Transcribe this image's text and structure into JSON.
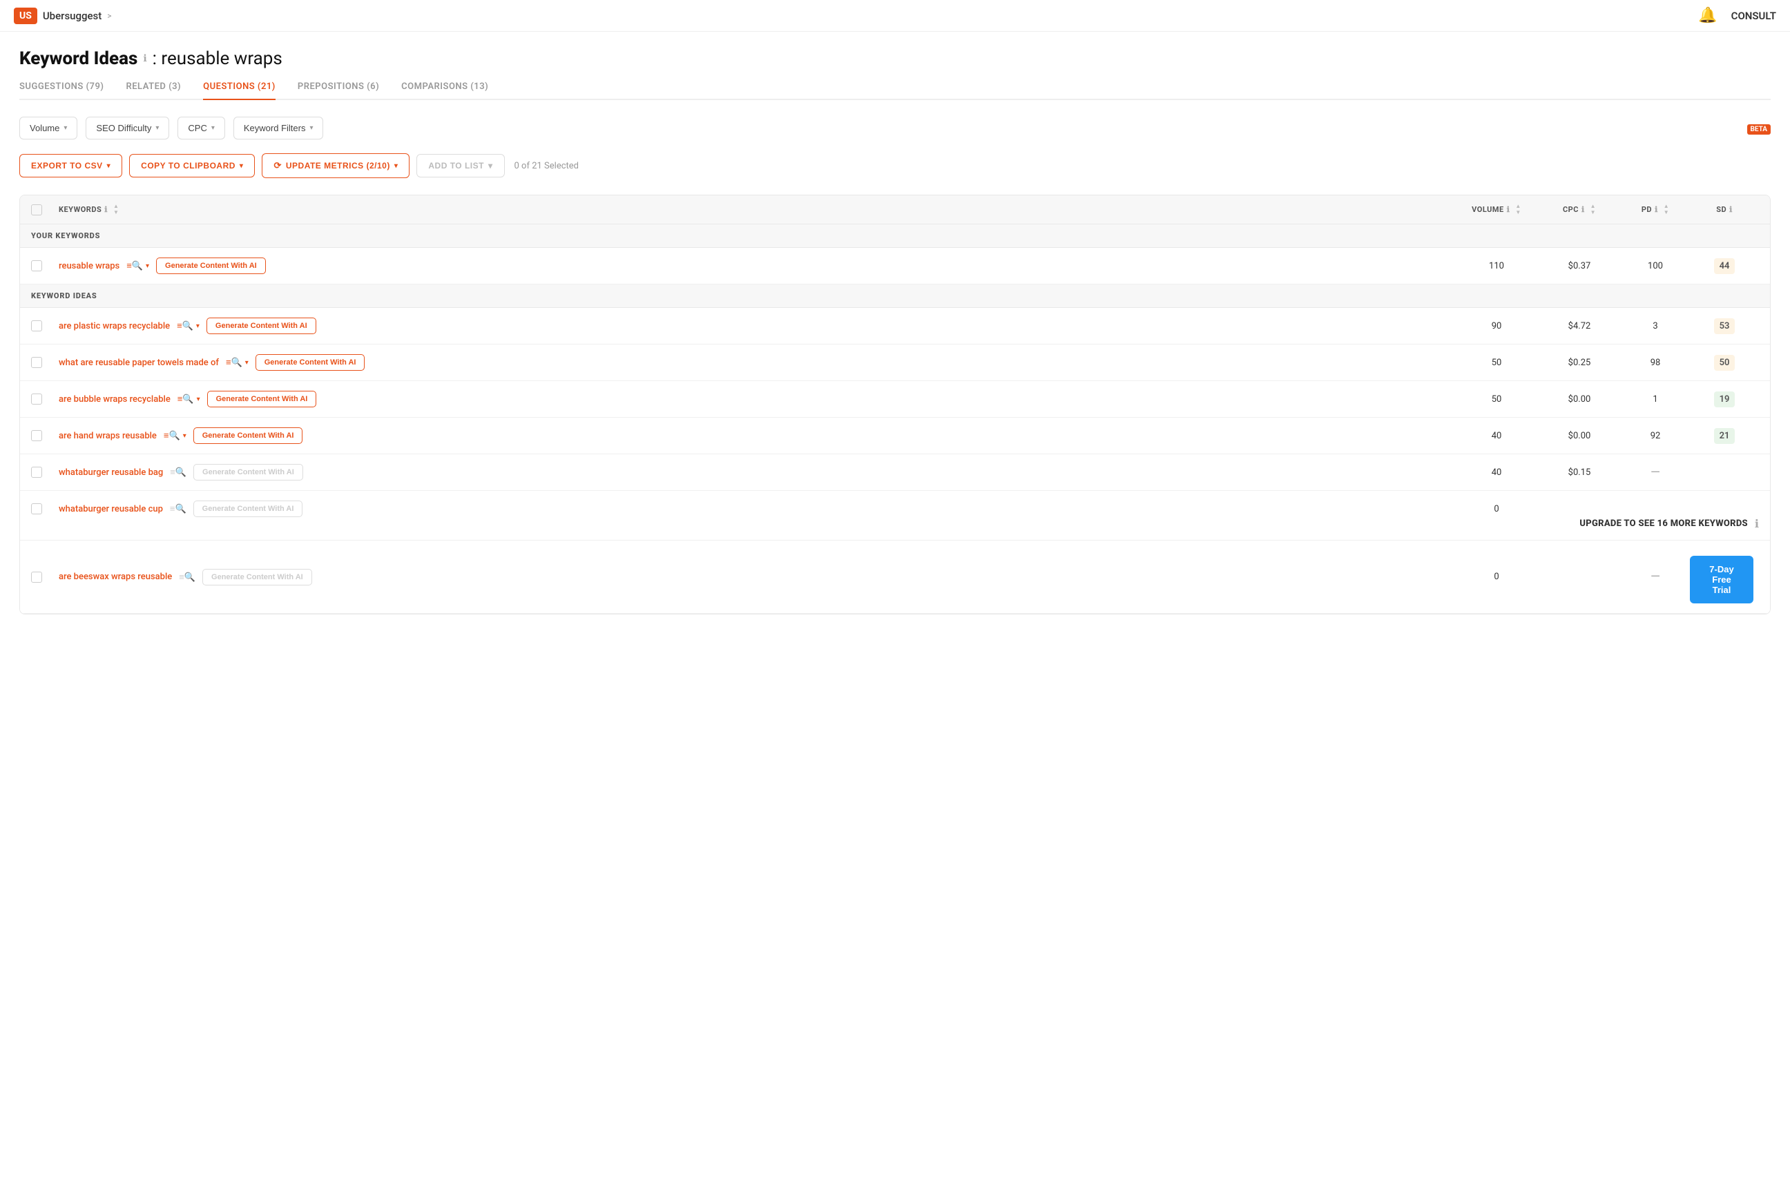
{
  "nav": {
    "logo": "US",
    "brand": "Ubersuggest",
    "chevron": ">",
    "bell": "🔔",
    "consult": "CONSULT"
  },
  "page": {
    "title": "Keyword Ideas",
    "keyword": ": reusable wraps"
  },
  "tabs": [
    {
      "label": "SUGGESTIONS (79)",
      "active": false
    },
    {
      "label": "RELATED (3)",
      "active": false
    },
    {
      "label": "QUESTIONS (21)",
      "active": true
    },
    {
      "label": "PREPOSITIONS (6)",
      "active": false
    },
    {
      "label": "COMPARISONS (13)",
      "active": false
    }
  ],
  "filters": [
    {
      "label": "Volume"
    },
    {
      "label": "SEO Difficulty"
    },
    {
      "label": "CPC"
    },
    {
      "label": "Keyword Filters"
    }
  ],
  "actions": {
    "export_csv": "EXPORT TO CSV",
    "copy_clipboard": "COPY TO CLIPBOARD",
    "update_metrics": "UPDATE METRICS (2/10)",
    "add_to_list": "ADD TO LIST",
    "selected_count": "0 of 21 Selected"
  },
  "table": {
    "columns": [
      "KEYWORDS",
      "VOLUME",
      "CPC",
      "PD",
      "SD"
    ],
    "your_keywords_label": "YOUR KEYWORDS",
    "keyword_ideas_label": "KEYWORD IDEAS",
    "your_keywords": [
      {
        "keyword": "reusable wraps",
        "volume": "110",
        "cpc": "$0.37",
        "pd": "100",
        "sd": "44",
        "sd_color": "yellow",
        "gen_btn": "Generate Content With AI",
        "gen_enabled": true
      }
    ],
    "keyword_ideas": [
      {
        "keyword": "are plastic wraps recyclable",
        "volume": "90",
        "cpc": "$4.72",
        "pd": "3",
        "sd": "53",
        "sd_color": "yellow",
        "gen_btn": "Generate Content With AI",
        "gen_enabled": true
      },
      {
        "keyword": "what are reusable paper towels made of",
        "volume": "50",
        "cpc": "$0.25",
        "pd": "98",
        "sd": "50",
        "sd_color": "yellow",
        "gen_btn": "Generate Content With AI",
        "gen_enabled": true
      },
      {
        "keyword": "are bubble wraps recyclable",
        "volume": "50",
        "cpc": "$0.00",
        "pd": "1",
        "sd": "19",
        "sd_color": "green",
        "gen_btn": "Generate Content With AI",
        "gen_enabled": true
      },
      {
        "keyword": "are hand wraps reusable",
        "volume": "40",
        "cpc": "$0.00",
        "pd": "92",
        "sd": "21",
        "sd_color": "green",
        "gen_btn": "Generate Content With AI",
        "gen_enabled": true
      },
      {
        "keyword": "whataburger reusable bag",
        "volume": "40",
        "cpc": "$0.15",
        "pd": "—",
        "sd": "",
        "sd_color": "none",
        "gen_btn": "Generate Content With AI",
        "gen_enabled": false
      },
      {
        "keyword": "whataburger reusable cup",
        "volume": "0",
        "cpc": "",
        "pd": "",
        "sd": "",
        "sd_color": "none",
        "gen_btn": "Generate Content With AI",
        "gen_enabled": false,
        "show_upgrade": true
      },
      {
        "keyword": "are beeswax wraps reusable",
        "volume": "0",
        "cpc": "",
        "pd": "—",
        "sd": "",
        "sd_color": "none",
        "gen_btn": "Generate Content With AI",
        "gen_enabled": false
      }
    ]
  },
  "upgrade": {
    "message": "UPGRADE TO SEE 16 MORE KEYWORDS",
    "button": "7-Day Free Trial"
  }
}
